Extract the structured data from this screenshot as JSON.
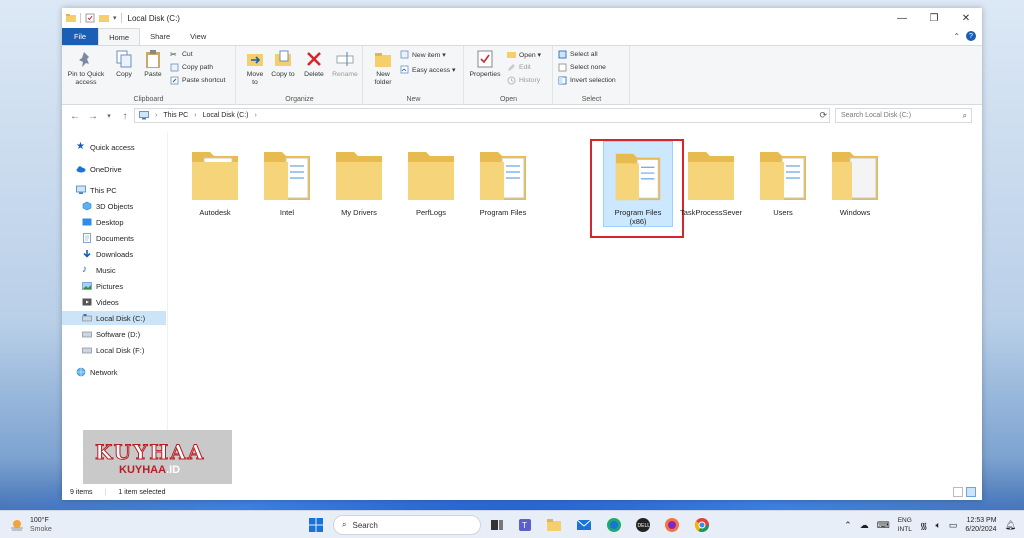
{
  "window": {
    "title": "Local Disk (C:)",
    "controls": {
      "minimize": "—",
      "maximize": "❐",
      "close": "✕"
    }
  },
  "tabs": [
    {
      "label": "File"
    },
    {
      "label": "Home"
    },
    {
      "label": "Share"
    },
    {
      "label": "View"
    }
  ],
  "ribbon": {
    "clipboard": {
      "label": "Clipboard",
      "pin": "Pin to Quick access",
      "copy": "Copy",
      "paste": "Paste",
      "cut": "Cut",
      "copy_path": "Copy path",
      "paste_shortcut": "Paste shortcut"
    },
    "organize": {
      "label": "Organize",
      "move_to": "Move to",
      "copy_to": "Copy to",
      "delete": "Delete",
      "rename": "Rename"
    },
    "new": {
      "label": "New",
      "new_folder": "New folder",
      "new_item": "New item ▾",
      "easy_access": "Easy access ▾"
    },
    "open": {
      "label": "Open",
      "properties": "Properties",
      "open": "Open ▾",
      "edit": "Edit",
      "history": "History"
    },
    "select": {
      "label": "Select",
      "select_all": "Select all",
      "select_none": "Select none",
      "invert": "Invert selection"
    }
  },
  "address": {
    "crumbs": [
      "This PC",
      "Local Disk (C:)"
    ],
    "search_placeholder": "Search Local Disk (C:)"
  },
  "navpane": {
    "quick_access": "Quick access",
    "onedrive": "OneDrive",
    "this_pc": "This PC",
    "objects3d": "3D Objects",
    "desktop": "Desktop",
    "documents": "Documents",
    "downloads": "Downloads",
    "music": "Music",
    "pictures": "Pictures",
    "videos": "Videos",
    "local_c": "Local Disk (C:)",
    "software_d": "Software (D:)",
    "local_f": "Local Disk (F:)",
    "network": "Network"
  },
  "folders": [
    {
      "name": "Autodesk"
    },
    {
      "name": "Intel"
    },
    {
      "name": "My Drivers"
    },
    {
      "name": "PerfLogs"
    },
    {
      "name": "Program Files"
    },
    {
      "name": "Program Files (x86)"
    },
    {
      "name": "TaskProcessSever"
    },
    {
      "name": "Users"
    },
    {
      "name": "Windows"
    }
  ],
  "status": {
    "count": "9 items",
    "selected": "1 item selected"
  },
  "watermark": {
    "line1": "KUYHAA",
    "line2a": "KUYHAA",
    "line2b": ".ID"
  },
  "taskbar": {
    "weather_temp": "100°F",
    "weather_desc": "Smoke",
    "search_label": "Search",
    "lang_top": "ENG",
    "lang_bottom": "INTL",
    "time": "12:53 PM",
    "date": "6/20/2024"
  },
  "colors": {
    "accent": "#1a5fb4",
    "folder": "#f4cf6b",
    "highlight": "#d6262d",
    "selection": "#cce8ff"
  }
}
